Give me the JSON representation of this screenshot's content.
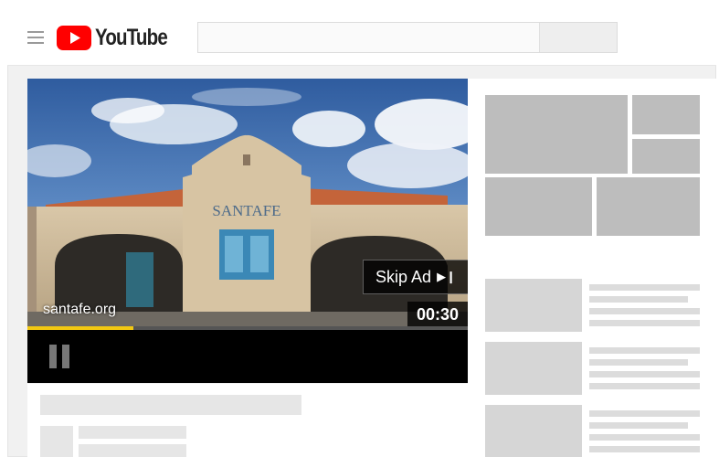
{
  "header": {
    "logo_text": "YouTube",
    "logo_color": "#ff0000",
    "search_value": ""
  },
  "player": {
    "advertiser_label": "santafe.org",
    "skip_label": "Skip Ad",
    "skip_icon": "skip-next-icon",
    "countdown": "00:30",
    "progress_fraction": 0.24,
    "progress_color": "#f2c812",
    "sign_text": "SANTAFE"
  },
  "icons": {
    "menu": "hamburger-icon",
    "play_logo": "youtube-play-icon",
    "pause": "pause-icon"
  }
}
